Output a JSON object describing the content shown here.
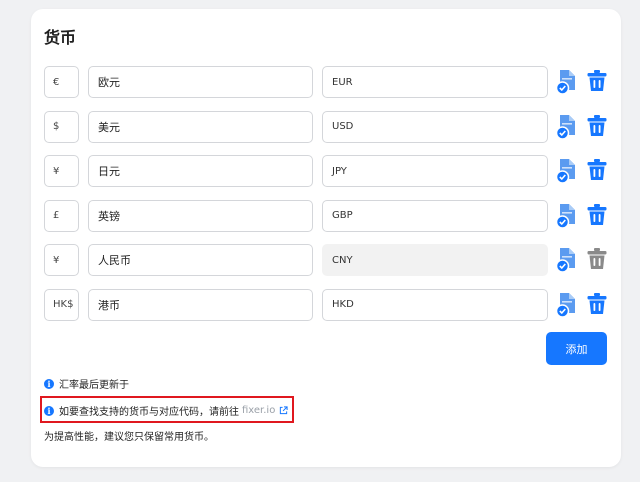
{
  "section": {
    "title": "货币"
  },
  "currencies": [
    {
      "symbol": "€",
      "name": "欧元",
      "code": "EUR",
      "code_disabled": false,
      "delete_enabled": true
    },
    {
      "symbol": "$",
      "name": "美元",
      "code": "USD",
      "code_disabled": false,
      "delete_enabled": true
    },
    {
      "symbol": "¥",
      "name": "日元",
      "code": "JPY",
      "code_disabled": false,
      "delete_enabled": true
    },
    {
      "symbol": "£",
      "name": "英镑",
      "code": "GBP",
      "code_disabled": false,
      "delete_enabled": true
    },
    {
      "symbol": "¥",
      "name": "人民币",
      "code": "CNY",
      "code_disabled": true,
      "delete_enabled": false
    },
    {
      "symbol": "HK$",
      "name": "港币",
      "code": "HKD",
      "code_disabled": false,
      "delete_enabled": true
    }
  ],
  "actions": {
    "add_label": "添加"
  },
  "info": {
    "last_updated": "汇率最后更新于",
    "lookup_text": "如要查找支持的货币与对应代码，请前往",
    "lookup_link": "fixer.io",
    "performance_tip": "为提高性能，建议您只保留常用货币。"
  },
  "colors": {
    "accent": "#1677ff",
    "disabled_icon": "#8a8a8a",
    "highlight_border": "#e0181f"
  },
  "icons": {
    "doc": "document-check-icon",
    "delete": "trash-icon",
    "info": "info-icon",
    "external": "external-link-icon"
  }
}
